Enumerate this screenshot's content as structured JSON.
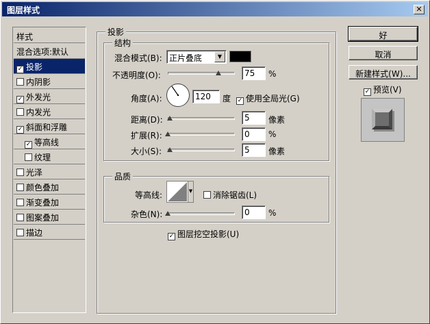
{
  "window": {
    "title": "图层样式",
    "close_glyph": "✕"
  },
  "styles_list": {
    "header": "样式",
    "blend_options": "混合选项:默认",
    "items": [
      {
        "label": "投影",
        "checked": true,
        "selected": true,
        "sub": false
      },
      {
        "label": "内阴影",
        "checked": false,
        "selected": false,
        "sub": false
      },
      {
        "label": "外发光",
        "checked": true,
        "selected": false,
        "sub": false
      },
      {
        "label": "内发光",
        "checked": false,
        "selected": false,
        "sub": false
      },
      {
        "label": "斜面和浮雕",
        "checked": true,
        "selected": false,
        "sub": false
      },
      {
        "label": "等高线",
        "checked": true,
        "selected": false,
        "sub": true
      },
      {
        "label": "纹理",
        "checked": false,
        "selected": false,
        "sub": true
      },
      {
        "label": "光泽",
        "checked": false,
        "selected": false,
        "sub": false
      },
      {
        "label": "颜色叠加",
        "checked": false,
        "selected": false,
        "sub": false
      },
      {
        "label": "渐变叠加",
        "checked": false,
        "selected": false,
        "sub": false
      },
      {
        "label": "图案叠加",
        "checked": false,
        "selected": false,
        "sub": false
      },
      {
        "label": "描边",
        "checked": false,
        "selected": false,
        "sub": false
      }
    ]
  },
  "drop_shadow": {
    "group_title": "投影",
    "structure": {
      "title": "结构",
      "blend_mode_label": "混合模式(B):",
      "blend_mode_value": "正片叠底",
      "shadow_color": "#000000",
      "opacity_label": "不透明度(O):",
      "opacity_value": "75",
      "opacity_unit": "%",
      "opacity_fraction": 0.75,
      "angle_label": "角度(A):",
      "angle_value": "120",
      "angle_unit": "度",
      "global_light_label": "使用全局光(G)",
      "global_light_checked": true,
      "distance_label": "距离(D):",
      "distance_value": "5",
      "distance_unit": "像素",
      "spread_label": "扩展(R):",
      "spread_value": "0",
      "spread_unit": "%",
      "size_label": "大小(S):",
      "size_value": "5",
      "size_unit": "像素"
    },
    "quality": {
      "title": "品质",
      "contour_label": "等高线:",
      "antialias_label": "消除锯齿(L)",
      "antialias_checked": false,
      "noise_label": "杂色(N):",
      "noise_value": "0",
      "noise_unit": "%"
    },
    "knockout_label": "图层挖空投影(U)",
    "knockout_checked": true
  },
  "buttons": {
    "ok": "好",
    "cancel": "取消",
    "new_style": "新建样式(W)...",
    "preview_label": "预览(V)",
    "preview_checked": true
  }
}
